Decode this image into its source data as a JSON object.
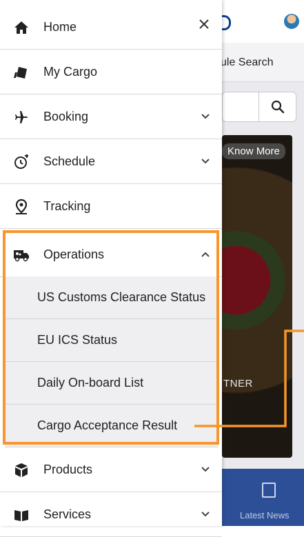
{
  "background": {
    "tab_partial": "ule Search",
    "banner_button": "Know More",
    "banner_text": "TNER",
    "bottom_tab": "Latest News"
  },
  "drawer": {
    "items": [
      {
        "label": "Home",
        "icon": "home-icon"
      },
      {
        "label": "My Cargo",
        "icon": "cargo-box-icon"
      },
      {
        "label": "Booking",
        "icon": "airplane-icon"
      },
      {
        "label": "Schedule",
        "icon": "schedule-icon"
      },
      {
        "label": "Tracking",
        "icon": "location-pin-icon"
      },
      {
        "label": "Operations",
        "icon": "truck-icon"
      },
      {
        "label": "Products",
        "icon": "package-icon"
      },
      {
        "label": "Services",
        "icon": "book-icon"
      }
    ],
    "operations_subitems": [
      {
        "label": "US Customs Clearance Status"
      },
      {
        "label": "EU ICS Status"
      },
      {
        "label": "Daily On-board List"
      },
      {
        "label": "Cargo Acceptance Result"
      }
    ]
  },
  "colors": {
    "highlight": "#f7962a",
    "brand_blue": "#2d4f97",
    "submenu_bg": "#efeff1"
  }
}
